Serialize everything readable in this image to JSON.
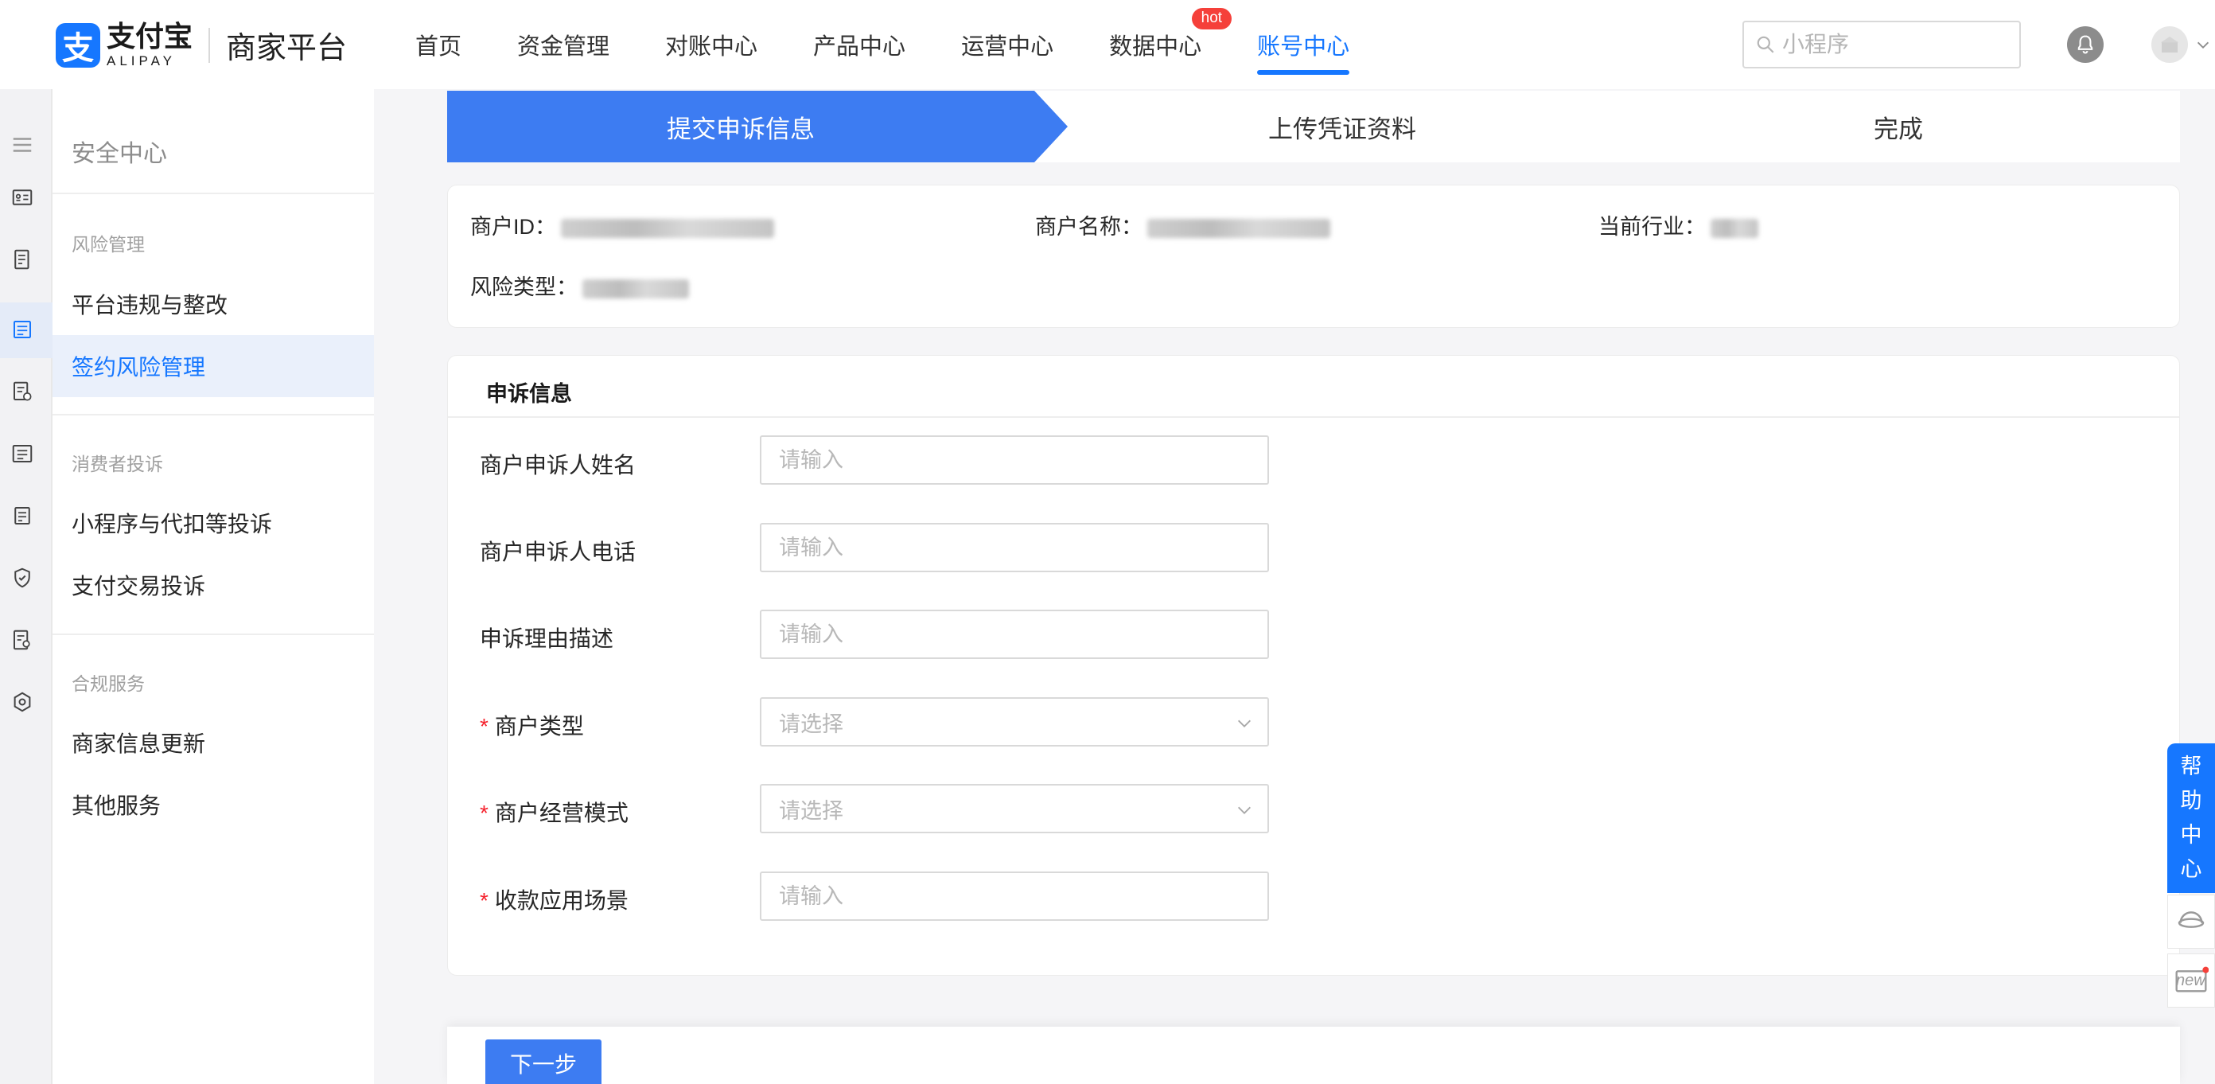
{
  "brand": {
    "logo_glyph": "支",
    "name_cn": "支付宝",
    "name_en": "ALIPAY",
    "platform": "商家平台",
    "color": "#1677ff"
  },
  "nav": {
    "items": [
      {
        "label": "首页"
      },
      {
        "label": "资金管理"
      },
      {
        "label": "对账中心"
      },
      {
        "label": "产品中心"
      },
      {
        "label": "运营中心"
      },
      {
        "label": "数据中心",
        "badge": "hot"
      },
      {
        "label": "账号中心",
        "active": true
      }
    ]
  },
  "search": {
    "placeholder": "小程序"
  },
  "rail": {
    "icons": [
      "menu-icon",
      "id-card-icon",
      "report-icon",
      "document-icon",
      "shield-document-icon",
      "list-icon",
      "note-icon",
      "shield-check-icon",
      "file-search-icon",
      "settings-hexagon-icon"
    ],
    "active_index": 3
  },
  "sidebar": {
    "title": "安全中心",
    "groups": [
      {
        "title": "风险管理",
        "items": [
          "平台违规与整改",
          "签约风险管理"
        ]
      },
      {
        "title": "消费者投诉",
        "items": [
          "小程序与代扣等投诉",
          "支付交易投诉"
        ]
      },
      {
        "title": "合规服务",
        "items": [
          "商家信息更新",
          "其他服务"
        ]
      }
    ],
    "active_item": "签约风险管理"
  },
  "steps": {
    "items": [
      "提交申诉信息",
      "上传凭证资料",
      "完成"
    ],
    "active_index": 0,
    "active_color": "#3d7cf2"
  },
  "merchant_info": {
    "merchant_id_label": "商户ID：",
    "merchant_name_label": "商户名称：",
    "industry_label": "当前行业：",
    "risk_type_label": "风险类型："
  },
  "appeal_form": {
    "section_title": "申诉信息",
    "fields": [
      {
        "label": "商户申诉人姓名",
        "type": "input",
        "placeholder": "请输入",
        "required": false
      },
      {
        "label": "商户申诉人电话",
        "type": "input",
        "placeholder": "请输入",
        "required": false
      },
      {
        "label": "申诉理由描述",
        "type": "input",
        "placeholder": "请输入",
        "required": false
      },
      {
        "label": "商户类型",
        "type": "select",
        "placeholder": "请选择",
        "required": true
      },
      {
        "label": "商户经营模式",
        "type": "select",
        "placeholder": "请选择",
        "required": true
      },
      {
        "label": "收款应用场景",
        "type": "input",
        "placeholder": "请输入",
        "required": true
      }
    ],
    "required_mark": "*"
  },
  "actions": {
    "next_label": "下一步"
  },
  "help": {
    "label_chars": [
      "帮",
      "助",
      "中",
      "心"
    ],
    "new_label": "new"
  }
}
